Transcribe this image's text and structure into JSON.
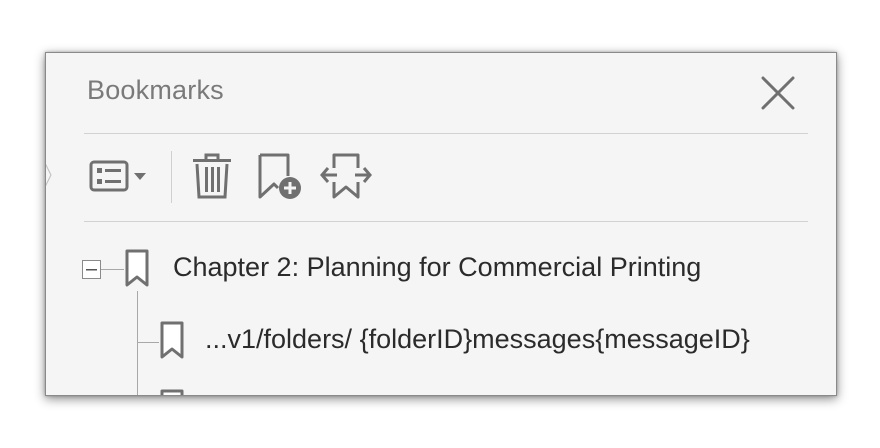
{
  "panel": {
    "title": "Bookmarks",
    "close_icon": "close-icon"
  },
  "toolbar": {
    "buttons": [
      {
        "name": "options",
        "icon": "list-options-icon"
      },
      {
        "name": "delete",
        "icon": "trash-icon"
      },
      {
        "name": "new-bookmark",
        "icon": "bookmark-add-icon"
      },
      {
        "name": "expand-bookmark",
        "icon": "bookmark-expand-icon"
      }
    ]
  },
  "tree": {
    "items": [
      {
        "label": "Chapter 2: Planning for Commercial Printing",
        "level": 0,
        "expanded": true
      },
      {
        "label": "...v1/folders/ {folderID}messages{messageID}",
        "level": 1
      }
    ]
  },
  "colors": {
    "icon": "#707070",
    "text": "#2b2b2b",
    "title": "#7a7a7a",
    "panel_bg": "#f5f5f5"
  }
}
